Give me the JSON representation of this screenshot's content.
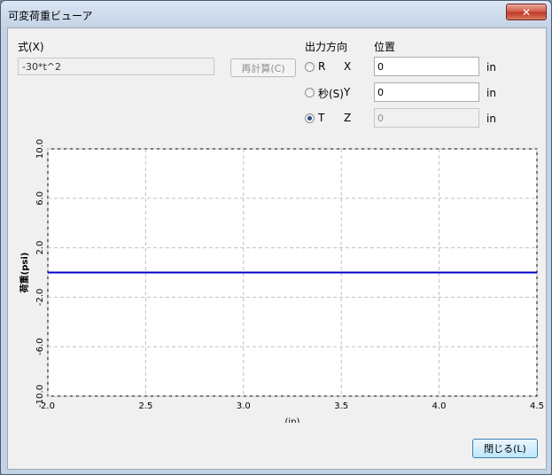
{
  "window": {
    "title": "可変荷重ビューア",
    "close_glyph": "✕"
  },
  "formula": {
    "label": "式(X)",
    "value": "-30*t^2",
    "recalc_label": "再計算(C)"
  },
  "output_direction": {
    "label": "出力方向",
    "options": [
      {
        "label": "R",
        "checked": false
      },
      {
        "label": "秒(S)",
        "checked": false
      },
      {
        "label": "T",
        "checked": true
      }
    ]
  },
  "position": {
    "label": "位置",
    "rows": [
      {
        "axis": "X",
        "value": "0",
        "unit": "in",
        "enabled": true
      },
      {
        "axis": "Y",
        "value": "0",
        "unit": "in",
        "enabled": true
      },
      {
        "axis": "Z",
        "value": "0",
        "unit": "in",
        "enabled": false
      }
    ]
  },
  "chart_data": {
    "type": "line",
    "xlabel": "(in)",
    "ylabel": "荷重(psi)",
    "xlim": [
      2.0,
      4.5
    ],
    "ylim": [
      -10.0,
      10.0
    ],
    "x_ticks": [
      "2.0",
      "2.5",
      "3.0",
      "3.5",
      "4.0",
      "4.5"
    ],
    "y_ticks": [
      "10.0",
      "6.0",
      "2.0",
      "-2.0",
      "-6.0",
      "-10.0"
    ],
    "grid": true,
    "series": [
      {
        "x": [
          2.0,
          4.5
        ],
        "y": [
          0.0,
          0.0
        ],
        "color": "#0000c8"
      }
    ]
  },
  "footer": {
    "close_label": "閉じる(L)"
  }
}
